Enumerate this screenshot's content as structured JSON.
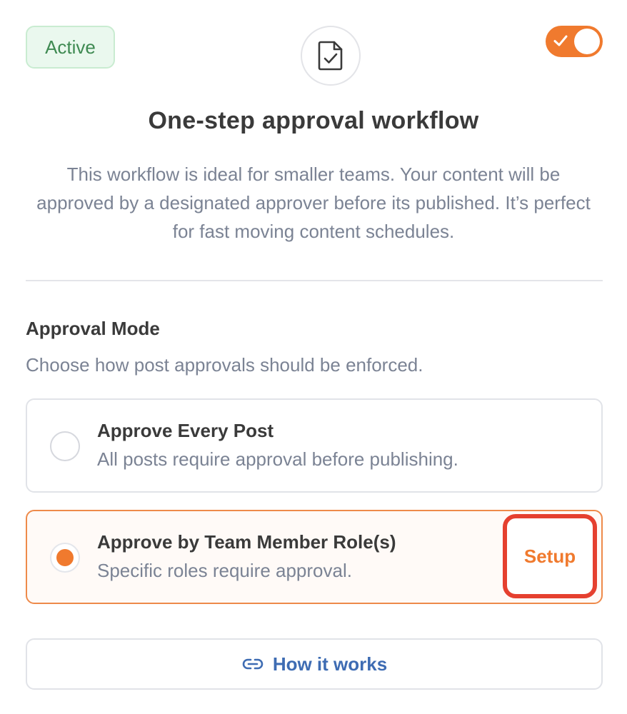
{
  "status_badge": "Active",
  "icons": {
    "document": "document-check-icon",
    "toggle_check": "check-icon",
    "link": "link-icon"
  },
  "toggle": {
    "state": "on"
  },
  "workflow": {
    "title": "One-step approval workflow",
    "description": "This workflow is ideal for smaller teams. Your content will be approved by a designated approver before its published. It’s perfect for fast moving content schedules."
  },
  "approval_mode": {
    "title": "Approval Mode",
    "subtitle": "Choose how post approvals should be enforced.",
    "options": [
      {
        "title": "Approve Every Post",
        "description": "All posts require approval before publishing.",
        "selected": false
      },
      {
        "title": "Approve by Team Member Role(s)",
        "description": "Specific roles require approval.",
        "selected": true,
        "action_label": "Setup"
      }
    ]
  },
  "how_it_works_label": "How it works",
  "colors": {
    "accent": "#f07a2e",
    "highlight_border": "#e5402f",
    "link": "#3e6cb3",
    "badge_bg": "#eaf8ee",
    "badge_text": "#3f8a52"
  }
}
